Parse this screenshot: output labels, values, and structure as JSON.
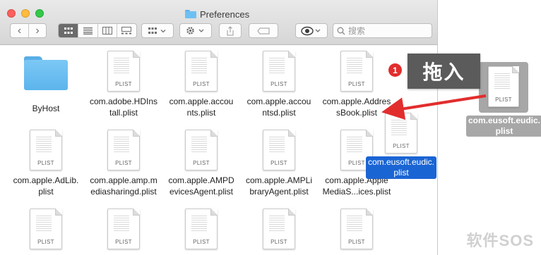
{
  "window": {
    "title": "Preferences"
  },
  "toolbar": {
    "back": "‹",
    "forward": "›",
    "search_placeholder": "搜索"
  },
  "files": [
    {
      "label": "ByHost",
      "type": "folder"
    },
    {
      "label": "com.adobe.HDInstall.plist",
      "type": "plist"
    },
    {
      "label": "com.apple.accounts.plist",
      "type": "plist"
    },
    {
      "label": "com.apple.accountsd.plist",
      "type": "plist"
    },
    {
      "label": "com.apple.AddressBook.plist",
      "type": "plist"
    },
    {
      "label": "com.apple.AdLib.plist",
      "type": "plist"
    },
    {
      "label": "com.apple.amp.mediasharingd.plist",
      "type": "plist"
    },
    {
      "label": "com.apple.AMPDevicesAgent.plist",
      "type": "plist"
    },
    {
      "label": "com.apple.AMPLibraryAgent.plist",
      "type": "plist"
    },
    {
      "label": "com.apple.AppleMediaS...ices.plist",
      "type": "plist"
    }
  ],
  "file_lines": {
    "f1a": "com.adobe.HDInstall.plist",
    "f1": [
      "com.adobe.HDIns",
      "tall.plist"
    ],
    "f2": [
      "com.apple.accou",
      "nts.plist"
    ],
    "f3": [
      "com.apple.accou",
      "ntsd.plist"
    ],
    "f4": [
      "com.apple.Addres",
      "sBook.plist"
    ],
    "f5": [
      "com.apple.AdLib.",
      "plist"
    ],
    "f6": [
      "com.apple.amp.m",
      "ediasharingd.plist"
    ],
    "f7": [
      "com.apple.AMPD",
      "evicesAgent.plist"
    ],
    "f8": [
      "com.apple.AMPLi",
      "braryAgent.plist"
    ],
    "f9": [
      "com.apple.Apple",
      "MediaS...ices.plist"
    ]
  },
  "plist_ext": "PLIST",
  "dragged_item": {
    "line1": "com.eusoft.eudic.",
    "line2": "plist",
    "ext": "PLIST"
  },
  "desktop_item": {
    "line1": "com.eusoft.eudic.",
    "line2": "plist",
    "ext": "PLIST"
  },
  "annotation": {
    "step": "1",
    "text": "拖入"
  },
  "watermark": "软件SOS",
  "colors": {
    "selection": "#1a65d4",
    "arrow": "#e22d2d",
    "folder": "#6ec0f2"
  }
}
